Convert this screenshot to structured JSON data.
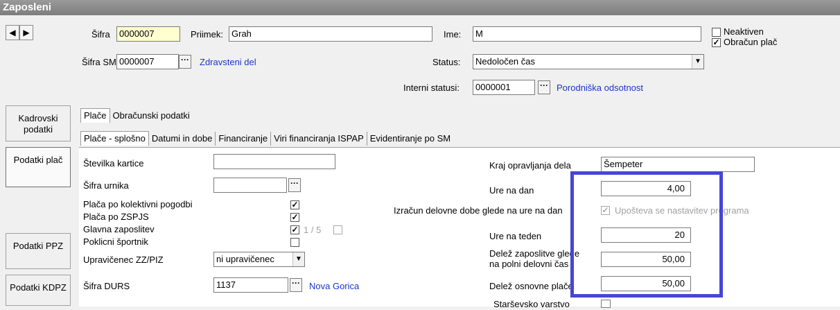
{
  "window": {
    "title": "Zaposleni"
  },
  "nav": {
    "prev_glyph": "◀",
    "next_glyph": "▶"
  },
  "header": {
    "sifra_label": "Šifra",
    "sifra_value": "0000007",
    "priimek_label": "Priimek:",
    "priimek_value": "Grah",
    "ime_label": "Ime:",
    "ime_value": "M",
    "sifra_sm_label": "Šifra SM",
    "sifra_sm_value": "0000007",
    "sifra_sm_link": "Zdravsteni del",
    "status_label": "Status:",
    "status_value": "Nedoločen čas",
    "interni_label": "Interni statusi:",
    "interni_value": "0000001",
    "interni_link": "Porodniška odsotnost",
    "neaktiven_label": "Neaktiven",
    "neaktiven_checked": false,
    "obracun_label": "Obračun plač",
    "obracun_checked": true
  },
  "sidebar": {
    "items": [
      {
        "label": "Kadrovski podatki"
      },
      {
        "label": "Podatki plač"
      },
      {
        "label": "Podatki PPZ"
      },
      {
        "label": "Podatki KDPZ"
      }
    ]
  },
  "tabs_top": [
    "Plače",
    "Obračunski podatki"
  ],
  "tabs_sub": [
    "Plače - splošno",
    "Datumi in dobe",
    "Financiranje",
    "Viri financiranja ISPAP",
    "Evidentiranje po SM"
  ],
  "form_left": {
    "stevilka_kartice_label": "Številka kartice",
    "stevilka_kartice_value": "",
    "sifra_urnika_label": "Šifra urnika",
    "sifra_urnika_value": "",
    "kolektivni_label": "Plača po kolektivni pogodbi",
    "zspjs_label": "Plača po ZSPJS",
    "glavna_label": "Glavna zaposlitev",
    "glavna_counter": "1 / 5",
    "poklicni_label": "Poklicni športnik",
    "upravicenec_label": "Upravičenec ZZ/PIZ",
    "upravicenec_value": "ni upravičenec",
    "durs_label": "Šifra DURS",
    "durs_value": "1137",
    "durs_link": "Nova Gorica"
  },
  "form_right": {
    "kraj_label": "Kraj opravljanja dela",
    "kraj_value": "Šempeter",
    "ure_dan_label": "Ure na dan",
    "ure_dan_value": "4,00",
    "izracun_label": "Izračun delovne dobe glede na ure na dan",
    "upostevaj_label": "Upošteva se nastavitev programa",
    "ure_teden_label": "Ure na teden",
    "ure_teden_value": "20",
    "delez_label_1": "Delež zaposlitve glede",
    "delez_label_2": "na polni delovni čas",
    "delez_value": "50,00",
    "delez_osnovne_label": "Delež osnovne plače",
    "delez_osnovne_value": "50,00",
    "starsevsko_label": "Starševsko varstvo"
  },
  "colors": {
    "highlight": "#4646d6",
    "link": "#1a35c8",
    "mandatory_field": "#fffecf"
  }
}
